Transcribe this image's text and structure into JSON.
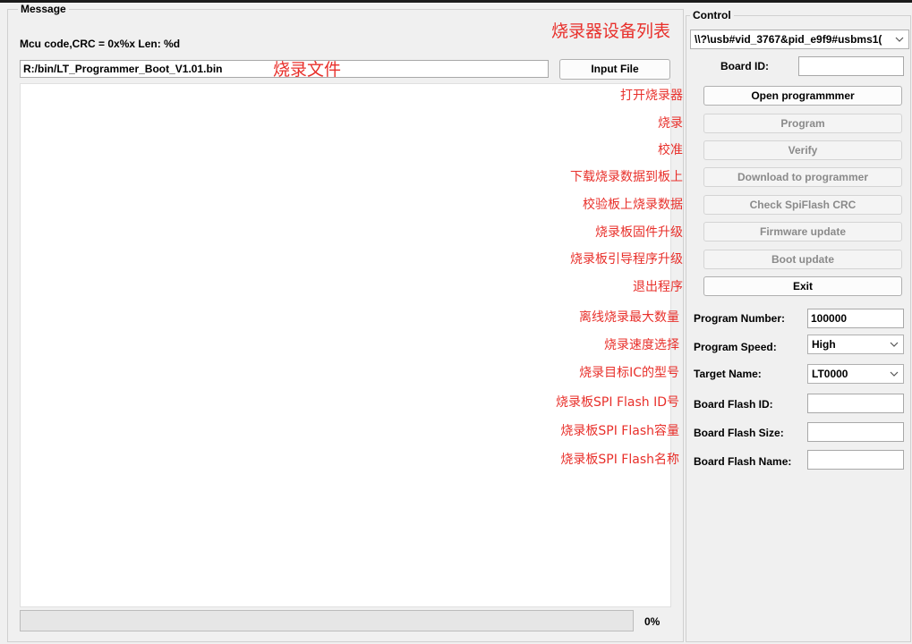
{
  "message_panel": {
    "title": "Message",
    "mcu_info": "Mcu code,CRC = 0x%x  Len: %d",
    "file_path": "R:/bin/LT_Programmer_Boot_V1.01.bin",
    "input_file_button": "Input File",
    "progress_value": 0,
    "progress_text": "0%"
  },
  "control_panel": {
    "title": "Control",
    "device_select": "\\\\?\\usb#vid_3767&pid_e9f9#usbms1(",
    "board_id_label": "Board ID:",
    "board_id_value": "",
    "buttons": {
      "open": "Open programmmer",
      "program": "Program",
      "verify": "Verify",
      "download": "Download to programmer",
      "check_crc": "Check SpiFlash CRC",
      "firmware_update": "Firmware update",
      "boot_update": "Boot update",
      "exit": "Exit"
    },
    "program_number_label": "Program Number:",
    "program_number_value": "100000",
    "program_speed_label": "Program Speed:",
    "program_speed_value": "High",
    "target_name_label": "Target Name:",
    "target_name_value": "LT0000",
    "flash_id_label": "Board Flash ID:",
    "flash_id_value": "",
    "flash_size_label": "Board Flash Size:",
    "flash_size_value": "",
    "flash_name_label": "Board Flash Name:",
    "flash_name_value": ""
  },
  "annotations": {
    "device_list": "烧录器设备列表",
    "burn_file": "烧录文件",
    "open": "打开烧录器",
    "program": "烧录",
    "verify": "校准",
    "download": "下载烧录数据到板上",
    "check_crc": "校验板上烧录数据",
    "firmware_update": "烧录板固件升级",
    "boot_update": "烧录板引导程序升级",
    "exit": "退出程序",
    "program_number": "离线烧录最大数量",
    "program_speed": "烧录速度选择",
    "target_name": "烧录目标IC的型号",
    "flash_id": "烧录板SPI Flash ID号",
    "flash_size": "烧录板SPI Flash容量",
    "flash_name": "烧录板SPI Flash名称"
  },
  "colors": {
    "annotation": "#e8302b",
    "window_bg": "#f0f0f0",
    "progress_fill": "#06b025"
  }
}
